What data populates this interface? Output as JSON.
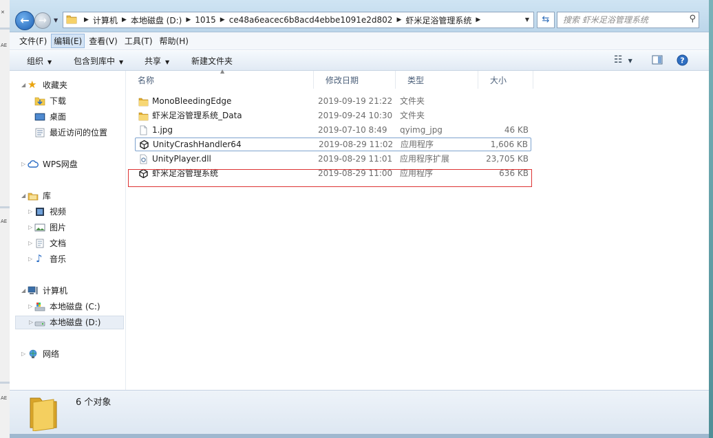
{
  "address": {
    "crumbs": [
      "计算机",
      "本地磁盘 (D:)",
      "1015",
      "ce48a6eacec6b8acd4ebbe1091e2d802",
      "虾米足浴管理系统"
    ],
    "search_placeholder": "搜索 虾米足浴管理系统"
  },
  "menu": {
    "items": [
      "文件(F)",
      "编辑(E)",
      "查看(V)",
      "工具(T)",
      "帮助(H)"
    ]
  },
  "toolbar": {
    "organize": "组织",
    "include_library": "包含到库中",
    "share": "共享",
    "new_folder": "新建文件夹"
  },
  "nav": {
    "favorites": "收藏夹",
    "downloads": "下载",
    "desktop": "桌面",
    "recent": "最近访问的位置",
    "wps": "WPS网盘",
    "libraries": "库",
    "videos": "视频",
    "pictures": "图片",
    "documents": "文档",
    "music": "音乐",
    "computer": "计算机",
    "drive_c": "本地磁盘 (C:)",
    "drive_d": "本地磁盘 (D:)",
    "network": "网络"
  },
  "columns": {
    "name": "名称",
    "date": "修改日期",
    "type": "类型",
    "size": "大小"
  },
  "files": [
    {
      "name": "MonoBleedingEdge",
      "date": "2019-09-19 21:22",
      "type": "文件夹",
      "size": "",
      "icon": "folder-icon"
    },
    {
      "name": "虾米足浴管理系统_Data",
      "date": "2019-09-24 10:30",
      "type": "文件夹",
      "size": "",
      "icon": "folder-icon"
    },
    {
      "name": "1.jpg",
      "date": "2019-07-10 8:49",
      "type": "qyimg_jpg",
      "size": "46 KB",
      "icon": "image-file-icon"
    },
    {
      "name": "UnityCrashHandler64",
      "date": "2019-08-29 11:02",
      "type": "应用程序",
      "size": "1,606 KB",
      "icon": "unity-app-icon"
    },
    {
      "name": "UnityPlayer.dll",
      "date": "2019-08-29 11:01",
      "type": "应用程序扩展",
      "size": "23,705 KB",
      "icon": "dll-file-icon"
    },
    {
      "name": "虾米足浴管理系统",
      "date": "2019-08-29 11:00",
      "type": "应用程序",
      "size": "636 KB",
      "icon": "unity-app-icon"
    }
  ],
  "status": {
    "count": "6 个对象"
  },
  "colors": {
    "highlight_box": "#dd3333",
    "selection": "#7da2ce"
  }
}
